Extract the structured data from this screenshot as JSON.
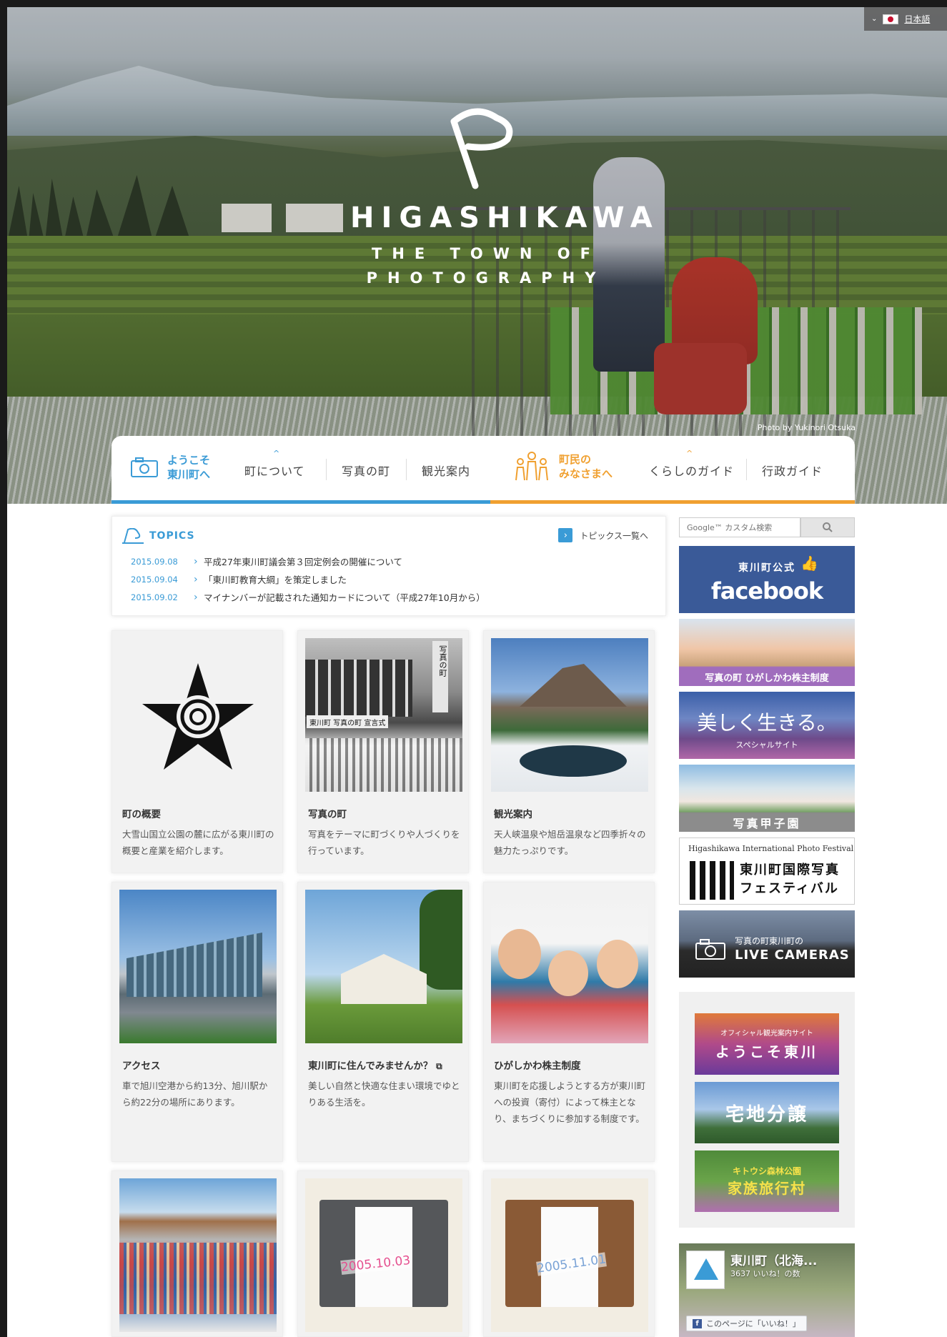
{
  "lang": {
    "label": "日本語"
  },
  "hero": {
    "title": "HIGASHIKAWA",
    "subtitle_line1": "THE TOWN OF",
    "subtitle_line2": "PHOTOGRAPHY",
    "credit": "Photo by Yukinori Otsuka"
  },
  "nav": {
    "welcome": {
      "line1": "ようこそ",
      "line2": "東川町へ"
    },
    "left_items": [
      "町について",
      "写真の町",
      "観光案内"
    ],
    "citizen": {
      "line1": "町民の",
      "line2": "みなさまへ"
    },
    "right_items": [
      "くらしのガイド",
      "行政ガイド"
    ],
    "colors": {
      "visitor": "#3a9bd6",
      "citizen": "#f0a030"
    }
  },
  "topics": {
    "heading": "TOPICS",
    "all_link": "トピックス一覧へ",
    "items": [
      {
        "date": "2015.09.08",
        "title": "平成27年東川町議会第３回定例会の開催について"
      },
      {
        "date": "2015.09.04",
        "title": "「東川町教育大綱」を策定しました"
      },
      {
        "date": "2015.09.02",
        "title": "マイナンバーが記載された通知カードについて（平成27年10月から）"
      }
    ]
  },
  "cards": [
    {
      "title": "町の概要",
      "text": "大雪山国立公園の麓に広がる東川町の概要と産業を紹介します。",
      "sign_text": "",
      "sign_vertical": ""
    },
    {
      "title": "写真の町",
      "text": "写真をテーマに町づくりや人づくりを行っています。",
      "sign_text": "東川町 写真の町 宣言式",
      "sign_vertical": "写真の町"
    },
    {
      "title": "観光案内",
      "text": "天人峡温泉や旭岳温泉など四季折々の魅力たっぷりです。",
      "sign_text": "",
      "sign_vertical": ""
    },
    {
      "title": "アクセス",
      "text": "車で旭川空港から約13分、旭川駅から約22分の場所にあります。",
      "sign_text": "",
      "sign_vertical": ""
    },
    {
      "title": "東川町に住んでみませんか？",
      "text": "美しい自然と快適な住まい環境でゆとりある生活を。",
      "sign_text": "",
      "sign_vertical": ""
    },
    {
      "title": "ひがしかわ株主制度",
      "text": "東川町を応援しようとする方が東川町への投資（寄付）によって株主となり、まちづくりに参加する制度です。",
      "sign_text": "",
      "sign_vertical": ""
    },
    {
      "title": "",
      "text": "",
      "sign_text": "",
      "sign_vertical": ""
    },
    {
      "title": "",
      "text": "",
      "sign_text": "2005.10.03",
      "sign_vertical": ""
    },
    {
      "title": "",
      "text": "",
      "sign_text": "2005.11.01",
      "sign_vertical": ""
    }
  ],
  "sidebar": {
    "search_placeholder": "Google™ カスタム検索",
    "facebook": {
      "line1": "東川町公式",
      "line2": "facebook"
    },
    "shareholder_banner": "写真の町 ひがしかわ株主制度",
    "beautiful": {
      "main": "美しく生きる。",
      "sub": "スペシャルサイト"
    },
    "koshien": "写真甲子園",
    "photo_fest": {
      "en": "Higashikawa International Photo Festival",
      "ja_line1": "東川町国際写真",
      "ja_line2": "フェスティバル"
    },
    "cameras": {
      "sub": "写真の町東川町の",
      "main": "LIVE CAMERAS"
    },
    "sub_banners": [
      {
        "small": "オフィシャル観光案内サイト",
        "main": "ようこそ東川"
      },
      {
        "small": "",
        "main": "宅地分譲"
      },
      {
        "small": "キトウシ森林公園",
        "main": "家族旅行村"
      }
    ],
    "fb_widget": {
      "name": "東川町（北海...",
      "likes": "3637 いいね！の数",
      "button": "このページに「いいね！」"
    }
  }
}
